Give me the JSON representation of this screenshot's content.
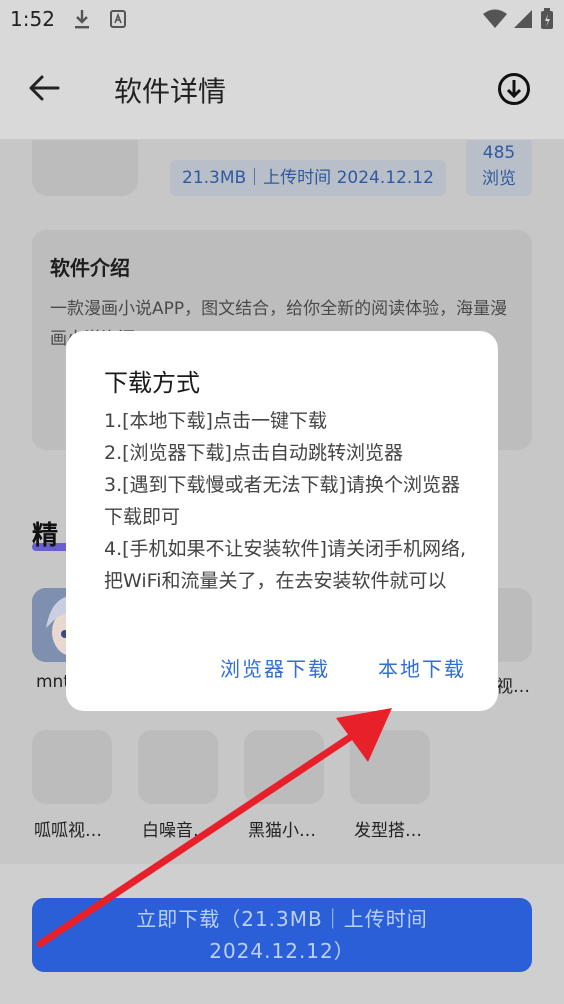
{
  "status_bar": {
    "time": "1:52"
  },
  "header": {
    "title": "软件详情"
  },
  "app_meta": {
    "info": "21.3MB｜上传时间 2024.12.12",
    "views_count": "485",
    "views_label": "浏览"
  },
  "intro": {
    "title": "软件介绍",
    "text": "一款漫画小说APP，图文结合，给你全新的阅读体验，海量漫画小说资源……"
  },
  "section": {
    "title": "精"
  },
  "apps_row1": [
    {
      "name": "mnt"
    },
    {
      "name": "视…"
    }
  ],
  "apps_row2": [
    {
      "name": "呱呱视…"
    },
    {
      "name": "白噪音…"
    },
    {
      "name": "黑猫小…"
    },
    {
      "name": "发型搭…"
    }
  ],
  "cta": {
    "line1": "立即下载（21.3MB｜上传时间",
    "line2": "2024.12.12）"
  },
  "dialog": {
    "title": "下载方式",
    "lines": [
      "1.[本地下载]点击一键下载",
      "2.[浏览器下载]点击自动跳转浏览器",
      "3.[遇到下载慢或者无法下载]请换个浏览器下载即可",
      "4.[手机如果不让安装软件]请关闭手机网络,把WiFi和流量关了，在去安装软件就可以"
    ],
    "browser_download": "浏览器下载",
    "local_download": "本地下载"
  },
  "colors": {
    "accent": "#2f6fd6",
    "annotation_arrow": "#e8202a"
  }
}
